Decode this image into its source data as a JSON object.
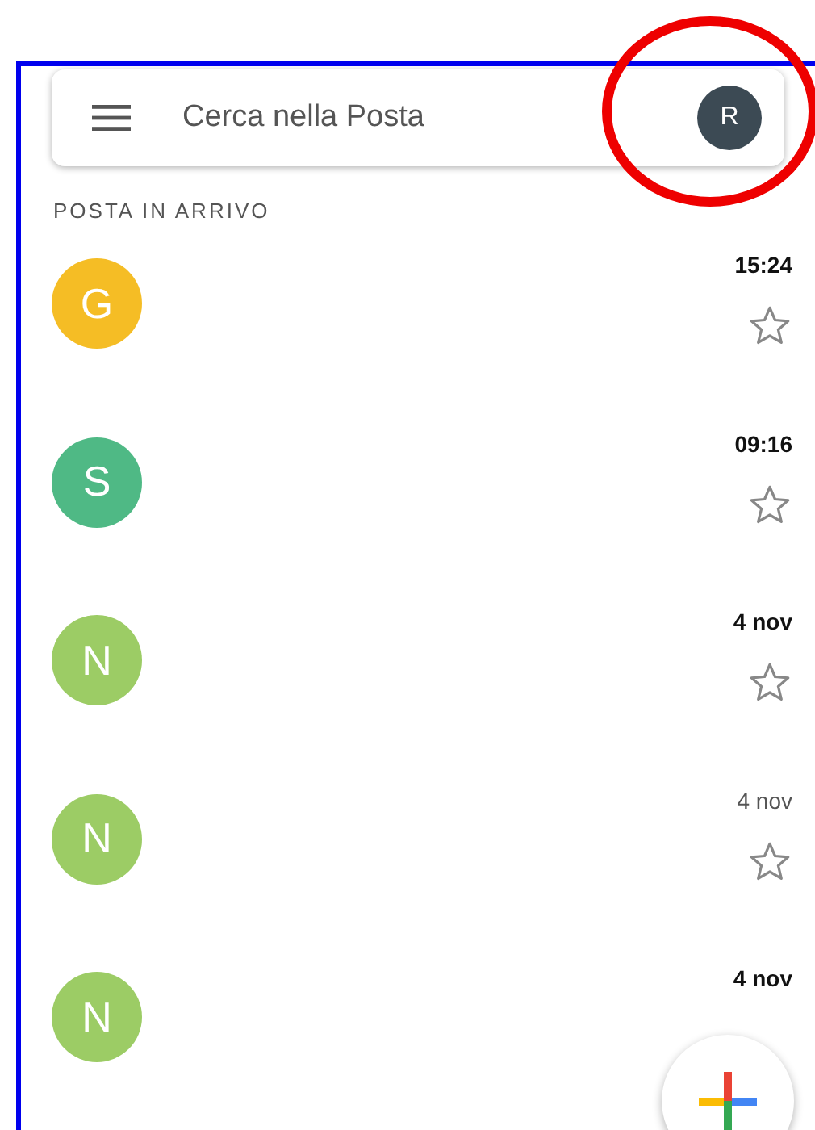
{
  "search": {
    "placeholder": "Cerca nella Posta",
    "avatar": "R"
  },
  "section_title": "POSTA IN ARRIVO",
  "emails": [
    {
      "avatar": "G",
      "color": "#f5bd25",
      "time": "15:24",
      "unread": true,
      "starred": false
    },
    {
      "avatar": "S",
      "color": "#4fb985",
      "time": "09:16",
      "unread": true,
      "starred": false
    },
    {
      "avatar": "N",
      "color": "#9ccc65",
      "time": "4 nov",
      "unread": true,
      "starred": false
    },
    {
      "avatar": "N",
      "color": "#9ccc65",
      "time": "4 nov",
      "unread": false,
      "starred": false
    },
    {
      "avatar": "N",
      "color": "#9ccc65",
      "time": "4 nov",
      "unread": true
    }
  ]
}
